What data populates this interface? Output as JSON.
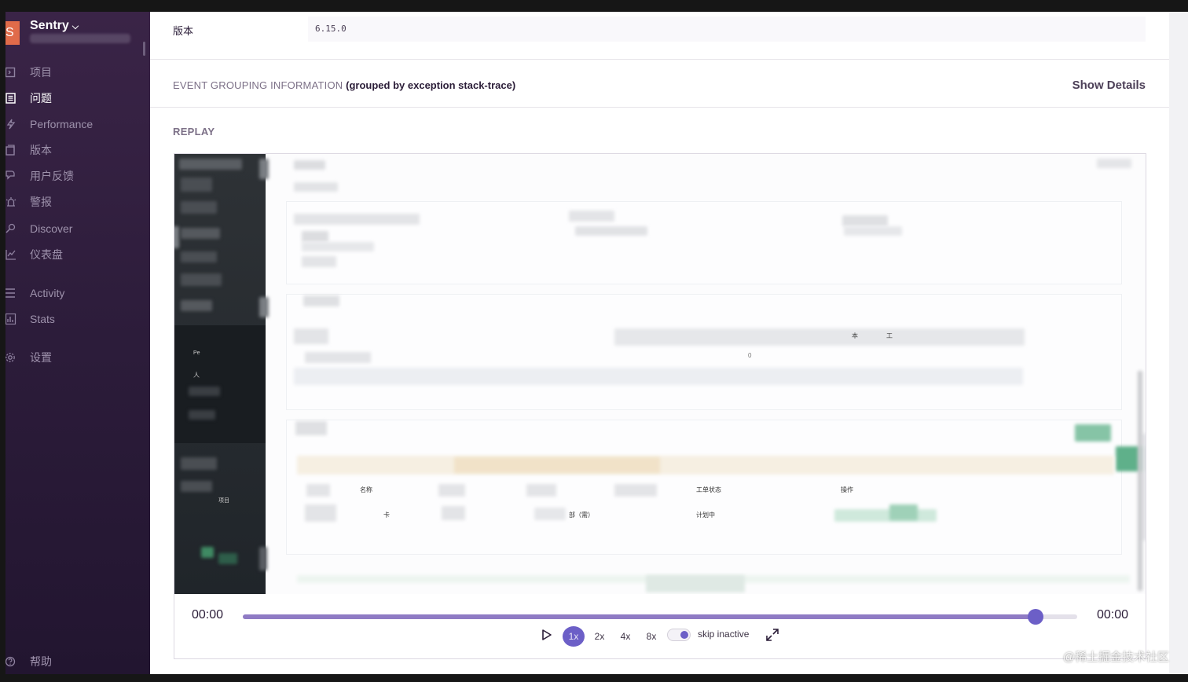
{
  "sidebar": {
    "org": {
      "avatar_letter": "S",
      "name": "Sentry"
    },
    "items": [
      {
        "label": "项目",
        "icon": "project-icon"
      },
      {
        "label": "问题",
        "icon": "issues-icon",
        "active": true
      },
      {
        "label": "Performance",
        "icon": "performance-icon"
      },
      {
        "label": "版本",
        "icon": "releases-icon"
      },
      {
        "label": "用户反馈",
        "icon": "user-feedback-icon"
      },
      {
        "label": "警报",
        "icon": "alerts-icon"
      },
      {
        "label": "Discover",
        "icon": "discover-icon"
      },
      {
        "label": "仪表盘",
        "icon": "dashboards-icon"
      },
      {
        "label": "Activity",
        "icon": "activity-icon"
      },
      {
        "label": "Stats",
        "icon": "stats-icon"
      },
      {
        "label": "设置",
        "icon": "settings-icon"
      }
    ],
    "help": {
      "label": "帮助",
      "icon": "help-icon"
    }
  },
  "event": {
    "version_key": "版本",
    "version_value": "6.15.0",
    "grouping_title": "EVENT GROUPING INFORMATION",
    "grouping_detail": "(grouped by exception stack-trace)",
    "show_details": "Show Details",
    "replay_label": "REPLAY"
  },
  "replay_preview": {
    "col_name": "名称",
    "col_status": "工单状态",
    "col_action": "操作",
    "cell_status": "计划中",
    "small_zero": "0",
    "small_ben": "本",
    "small_gong": "工",
    "side_item": "项目",
    "side_pe": "Pe",
    "side_ren": "人",
    "cell_ka": "卡",
    "cell_bu": "部（需）"
  },
  "player": {
    "time_current": "00:00",
    "time_total": "00:00",
    "progress": 0.95,
    "speeds": [
      "1x",
      "2x",
      "4x",
      "8x"
    ],
    "active_speed": "1x",
    "skip_inactive_label": "skip inactive",
    "skip_inactive_on": true
  },
  "watermark": "@稀土掘金技术社区",
  "colors": {
    "accent": "#6c5fc7",
    "sidebar_top": "#3a2447",
    "sidebar_bottom": "#221530"
  }
}
